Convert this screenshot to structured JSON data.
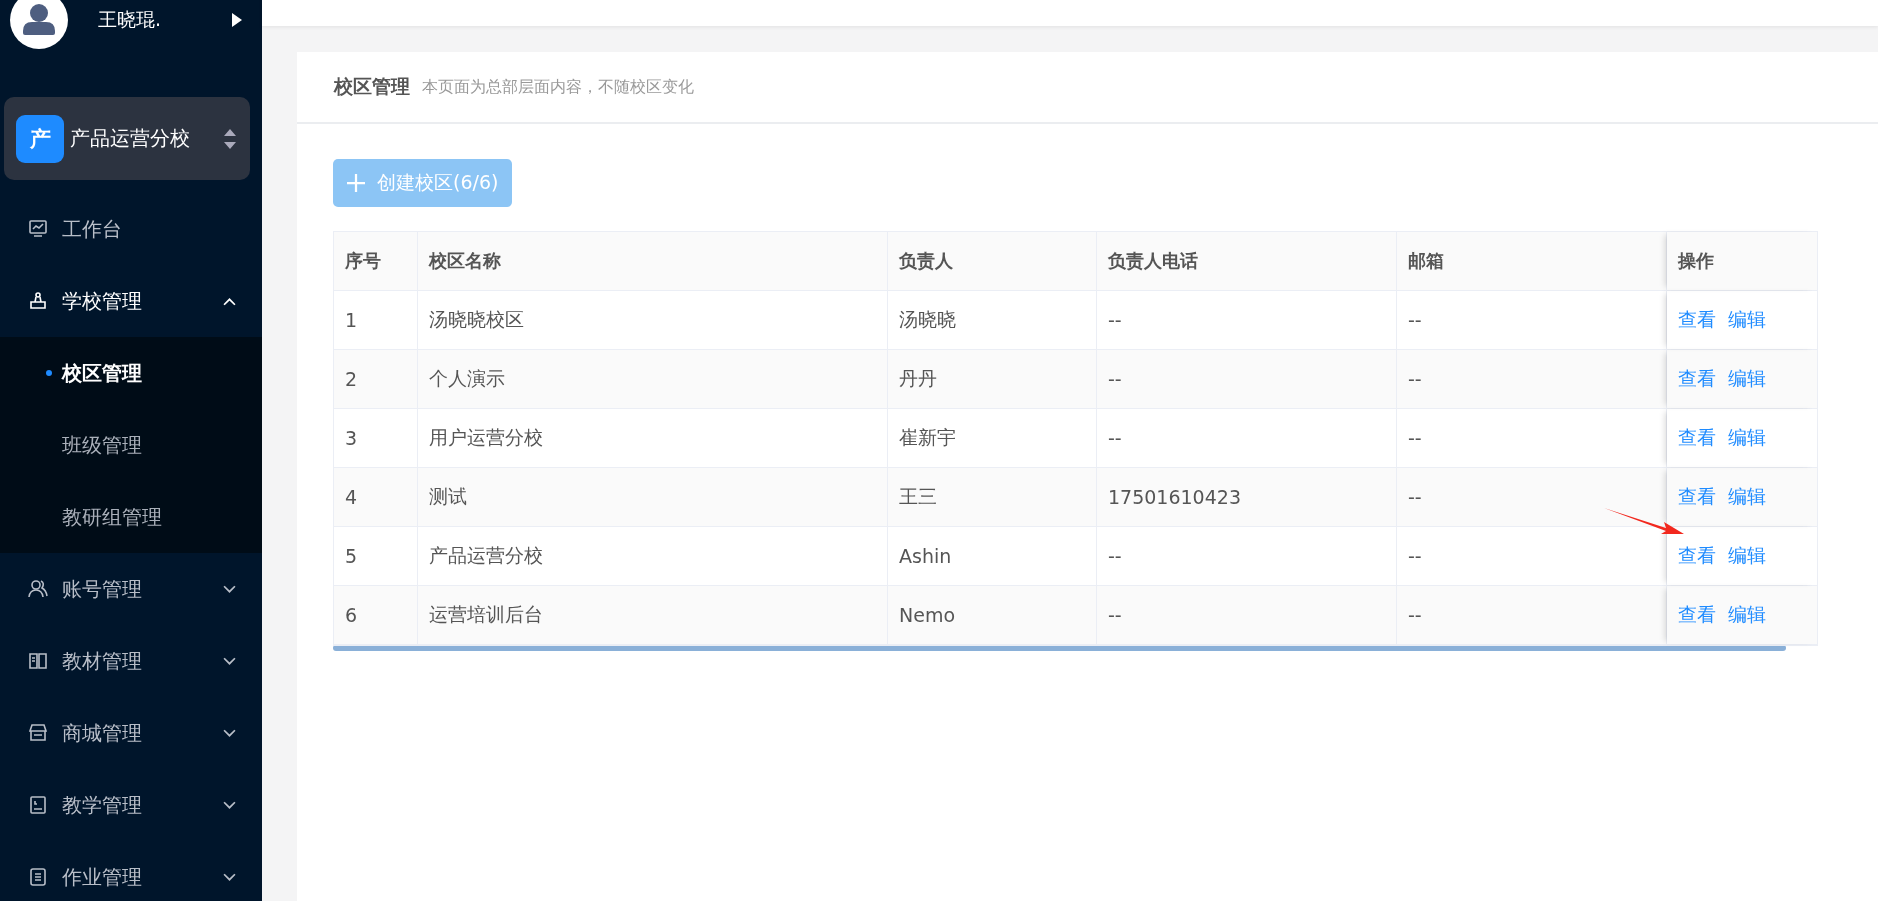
{
  "user": {
    "name": "王晓琨."
  },
  "school_switcher": {
    "badge": "产",
    "name": "产品运营分校"
  },
  "sidebar": {
    "items": [
      {
        "label": "工作台",
        "kind": "link"
      },
      {
        "label": "学校管理",
        "kind": "group",
        "expanded": true,
        "children": [
          {
            "label": "校区管理",
            "selected": true
          },
          {
            "label": "班级管理",
            "selected": false
          },
          {
            "label": "教研组管理",
            "selected": false
          }
        ]
      },
      {
        "label": "账号管理",
        "kind": "group",
        "expanded": false
      },
      {
        "label": "教材管理",
        "kind": "group",
        "expanded": false
      },
      {
        "label": "商城管理",
        "kind": "group",
        "expanded": false
      },
      {
        "label": "教学管理",
        "kind": "group",
        "expanded": false
      },
      {
        "label": "作业管理",
        "kind": "group",
        "expanded": false
      }
    ]
  },
  "page": {
    "title": "校区管理",
    "subtitle": "本页面为总部层面内容，不随校区变化"
  },
  "create_button": {
    "label": "创建校区(6/6)",
    "disabled": true
  },
  "table": {
    "columns": [
      "序号",
      "校区名称",
      "负责人",
      "负责人电话",
      "邮箱",
      "操作"
    ],
    "rows": [
      {
        "cells": [
          "1",
          "汤晓晓校区",
          "汤晓晓",
          "--",
          "--"
        ],
        "actions": [
          "查看",
          "编辑"
        ]
      },
      {
        "cells": [
          "2",
          "个人演示",
          "丹丹",
          "--",
          "--"
        ],
        "actions": [
          "查看",
          "编辑"
        ]
      },
      {
        "cells": [
          "3",
          "用户运营分校",
          "崔新宇",
          "--",
          "--"
        ],
        "actions": [
          "查看",
          "编辑"
        ]
      },
      {
        "cells": [
          "4",
          "测试",
          "王三",
          "17501610423",
          "--"
        ],
        "actions": [
          "查看",
          "编辑"
        ]
      },
      {
        "cells": [
          "5",
          "产品运营分校",
          "Ashin",
          "--",
          "--"
        ],
        "actions": [
          "查看",
          "编辑"
        ]
      },
      {
        "cells": [
          "6",
          "运营培训后台",
          "Nemo",
          "--",
          "--"
        ],
        "actions": [
          "查看",
          "编辑"
        ]
      }
    ]
  }
}
